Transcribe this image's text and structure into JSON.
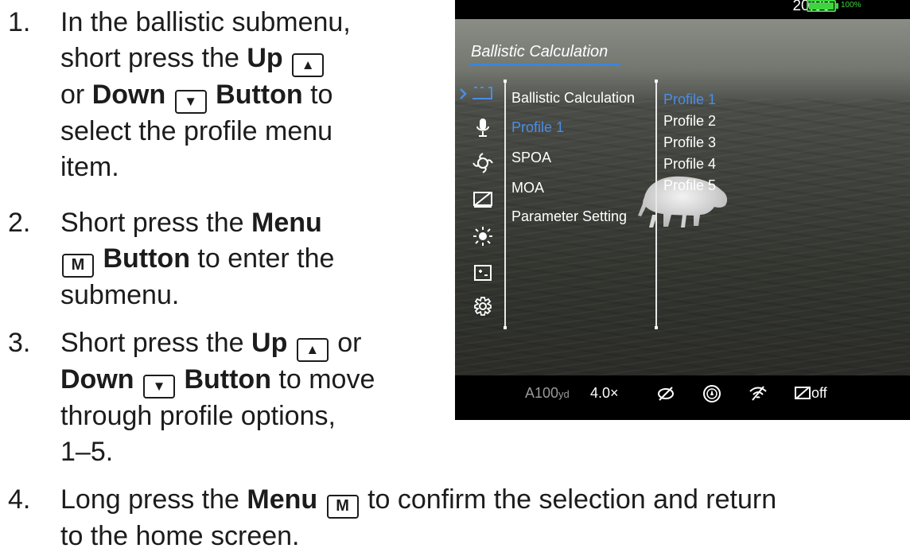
{
  "steps": [
    {
      "num": "1.",
      "l1": "In the ballistic submenu,",
      "l2a": "short press the ",
      "up": "Up",
      "l3a": "or ",
      "down": "Down",
      "button": "Button",
      "l3b": " to",
      "l4": "select the profile menu",
      "l5": "item."
    },
    {
      "num": "2.",
      "l1": "Short press the ",
      "menu": "Menu",
      "button": "Button",
      "l2b": " to enter the",
      "l3": "submenu."
    },
    {
      "num": "3.",
      "l1a": "Short press the ",
      "up": "Up",
      "l1b": " or",
      "down": "Down",
      "button": "Button",
      "l2b": " to move",
      "l3": "through profile options,",
      "l4": "1–5."
    },
    {
      "num": "4.",
      "l1a": "Long press the ",
      "menu": "Menu",
      "l1b": " to confirm the selection and return",
      "l2": "to the home screen."
    }
  ],
  "keys": {
    "up": "▲",
    "down": "▼",
    "menu": "M"
  },
  "device": {
    "clock": "20:00",
    "battery_pct": "100%",
    "battery_level": 1.0,
    "menu_title": "Ballistic Calculation",
    "menu_items": [
      "Ballistic Calculation",
      "Profile 1",
      "SPOA",
      "MOA",
      "Parameter Setting"
    ],
    "selected_item": "Profile 1",
    "profiles": [
      "Profile 1",
      "Profile 2",
      "Profile 3",
      "Profile 4",
      "Profile 5"
    ],
    "selected_profile": "Profile 1",
    "side_icons": [
      "ballistic-bracket-icon",
      "microphone-icon",
      "hotspot-icon",
      "display-off-icon",
      "brightness-icon",
      "zoom-frame-icon",
      "settings-gear-icon"
    ],
    "bottom": {
      "distance": "A100",
      "distance_unit": "yd",
      "zoom": "4.0×",
      "wifi_off": "off"
    },
    "colors": {
      "accent": "#4a8de6",
      "battery": "#3fd43f"
    }
  }
}
